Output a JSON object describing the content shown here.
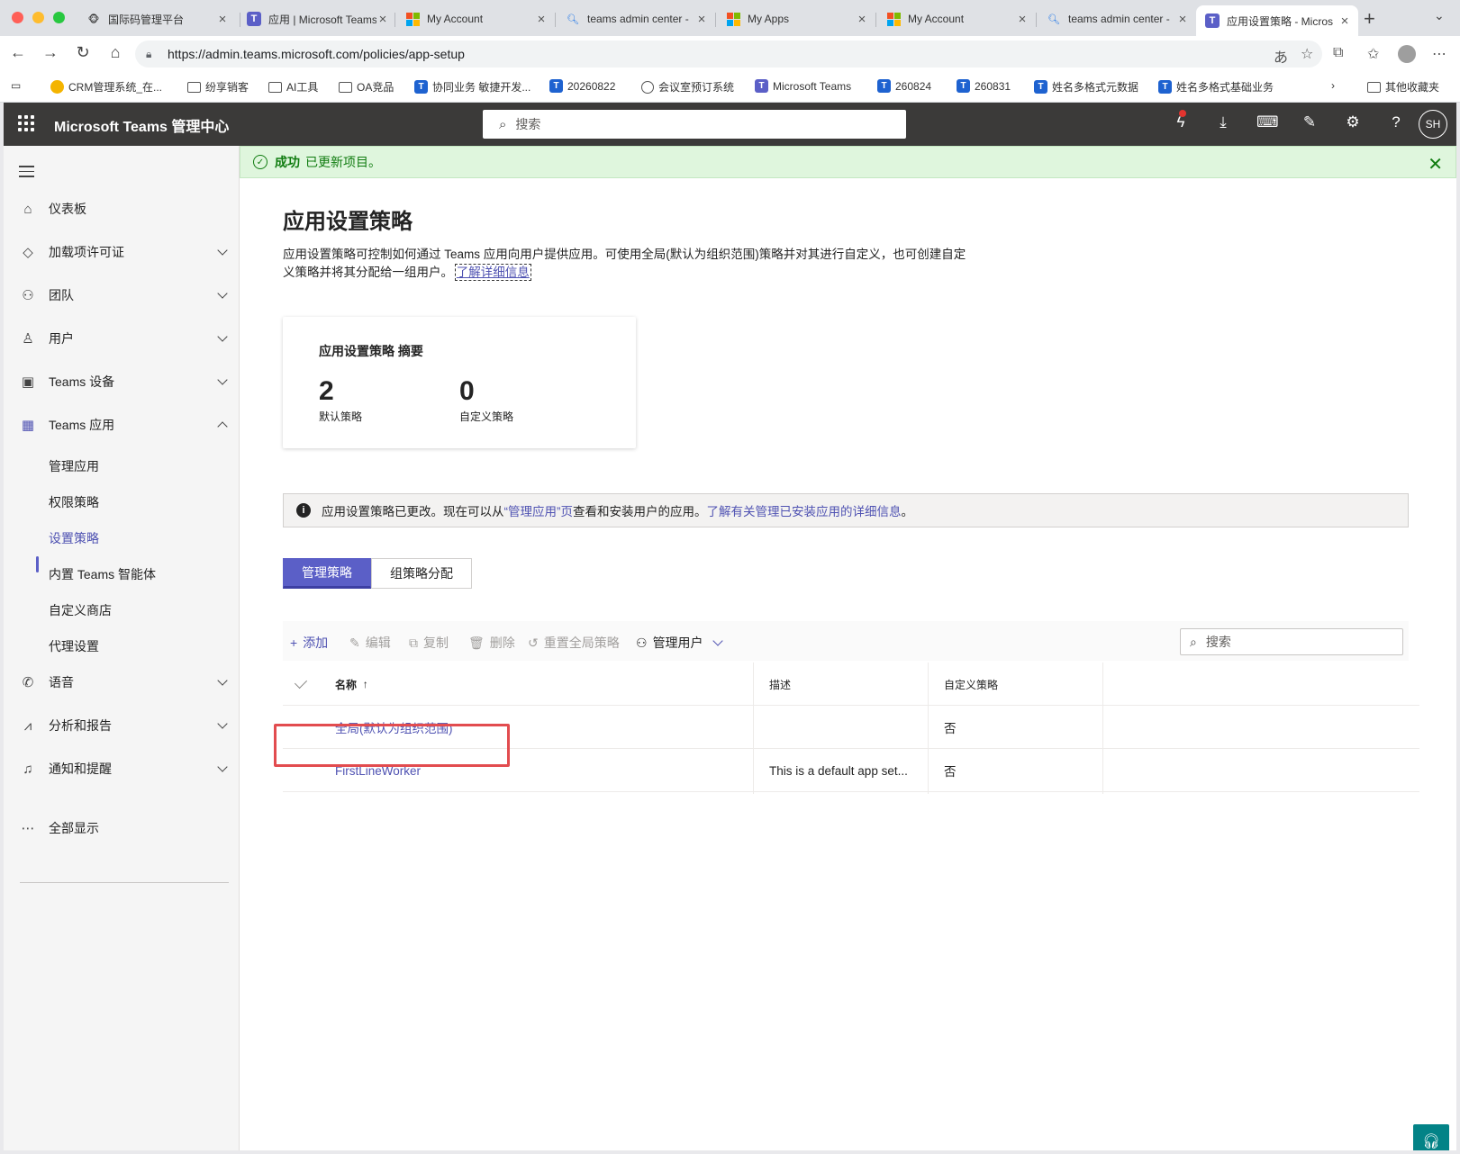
{
  "browser": {
    "tabs": [
      {
        "title": "国际码管理平台",
        "favicon": "crm-icon",
        "active": false
      },
      {
        "title": "应用 | Microsoft Teams",
        "favicon": "teams-icon",
        "active": false
      },
      {
        "title": "My Account",
        "favicon": "microsoft-icon",
        "active": false
      },
      {
        "title": "teams admin center -",
        "favicon": "search-icon",
        "active": false
      },
      {
        "title": "My Apps",
        "favicon": "microsoft-icon",
        "active": false
      },
      {
        "title": "My Account",
        "favicon": "microsoft-icon",
        "active": false
      },
      {
        "title": "teams admin center -",
        "favicon": "search-icon",
        "active": false
      },
      {
        "title": "应用设置策略 - Micros",
        "favicon": "teams-icon",
        "active": true
      }
    ],
    "url": "https://admin.teams.microsoft.com/policies/app-setup",
    "bookmarks": [
      {
        "label": "CRM管理系统_在...",
        "icon": "crm-icon"
      },
      {
        "label": "纷享销客",
        "icon": "folder-icon"
      },
      {
        "label": "AI工具",
        "icon": "folder-icon"
      },
      {
        "label": "OA竞品",
        "icon": "folder-icon"
      },
      {
        "label": "协同业务 敏捷开发...",
        "icon": "tower-icon"
      },
      {
        "label": "20260822",
        "icon": "tower-icon"
      },
      {
        "label": "会议室预订系统",
        "icon": "globe-icon"
      },
      {
        "label": "Microsoft Teams",
        "icon": "teams-icon"
      },
      {
        "label": "260824",
        "icon": "tower-icon"
      },
      {
        "label": "260831",
        "icon": "tower-icon"
      },
      {
        "label": "姓名多格式元数据",
        "icon": "tower-icon"
      },
      {
        "label": "姓名多格式基础业务",
        "icon": "tower-icon"
      }
    ],
    "other_bookmarks": "其他收藏夹"
  },
  "header": {
    "app_title": "Microsoft Teams 管理中心",
    "search_placeholder": "搜索",
    "avatar_initials": "SH"
  },
  "sidebar": {
    "items": [
      {
        "label": "仪表板",
        "icon": "home-icon",
        "expandable": false
      },
      {
        "label": "加载项许可证",
        "icon": "diamond-icon",
        "expandable": true
      },
      {
        "label": "团队",
        "icon": "team-icon",
        "expandable": true
      },
      {
        "label": "用户",
        "icon": "user-icon",
        "expandable": true
      },
      {
        "label": "Teams 设备",
        "icon": "devices-icon",
        "expandable": true
      },
      {
        "label": "Teams 应用",
        "icon": "apps-icon",
        "expandable": true,
        "expanded": true
      },
      {
        "label": "语音",
        "icon": "phone-icon",
        "expandable": true
      },
      {
        "label": "分析和报告",
        "icon": "chart-icon",
        "expandable": true
      },
      {
        "label": "通知和提醒",
        "icon": "bell-icon",
        "expandable": true
      }
    ],
    "sub_items": [
      "管理应用",
      "权限策略",
      "设置策略",
      "内置 Teams 智能体",
      "自定义商店",
      "代理设置"
    ],
    "selected_sub": "设置策略",
    "show_all": "全部显示"
  },
  "banner": {
    "status": "成功",
    "message": "已更新项目。"
  },
  "page": {
    "title": "应用设置策略",
    "description": "应用设置策略可控制如何通过 Teams 应用向用户提供应用。可使用全局(默认为组织范围)策略并对其进行自定义，也可创建自定义策略并将其分配给一组用户。",
    "learn_more": "了解详细信息"
  },
  "summary": {
    "title": "应用设置策略 摘要",
    "default_count": "2",
    "default_label": "默认策略",
    "custom_count": "0",
    "custom_label": "自定义策略"
  },
  "info": {
    "text_before": "应用设置策略已更改。现在可以从 ",
    "link1": "“管理应用”页",
    "text_middle": " 查看和安装用户的应用。",
    "link2": "了解有关管理已安装应用的详细信息",
    "text_after": "。"
  },
  "tabs": [
    {
      "label": "管理策略",
      "active": true
    },
    {
      "label": "组策略分配",
      "active": false
    }
  ],
  "toolbar": {
    "add": "添加",
    "edit": "编辑",
    "copy": "复制",
    "delete": "删除",
    "reset": "重置全局策略",
    "manage_users": "管理用户",
    "search_placeholder": "搜索"
  },
  "table": {
    "columns": [
      "名称",
      "描述",
      "自定义策略"
    ],
    "sort_indicator": "↑",
    "rows": [
      {
        "name": "全局(默认为组织范围)",
        "description": "",
        "custom": "否"
      },
      {
        "name": "FirstLineWorker",
        "description": "This is a default app set...",
        "custom": "否"
      }
    ]
  },
  "colors": {
    "accent": "#5b5fc7",
    "link": "#4f52b2",
    "success_bg": "#dff6dd",
    "highlight": "#e24c4f",
    "header_bg": "#3b3a39"
  }
}
